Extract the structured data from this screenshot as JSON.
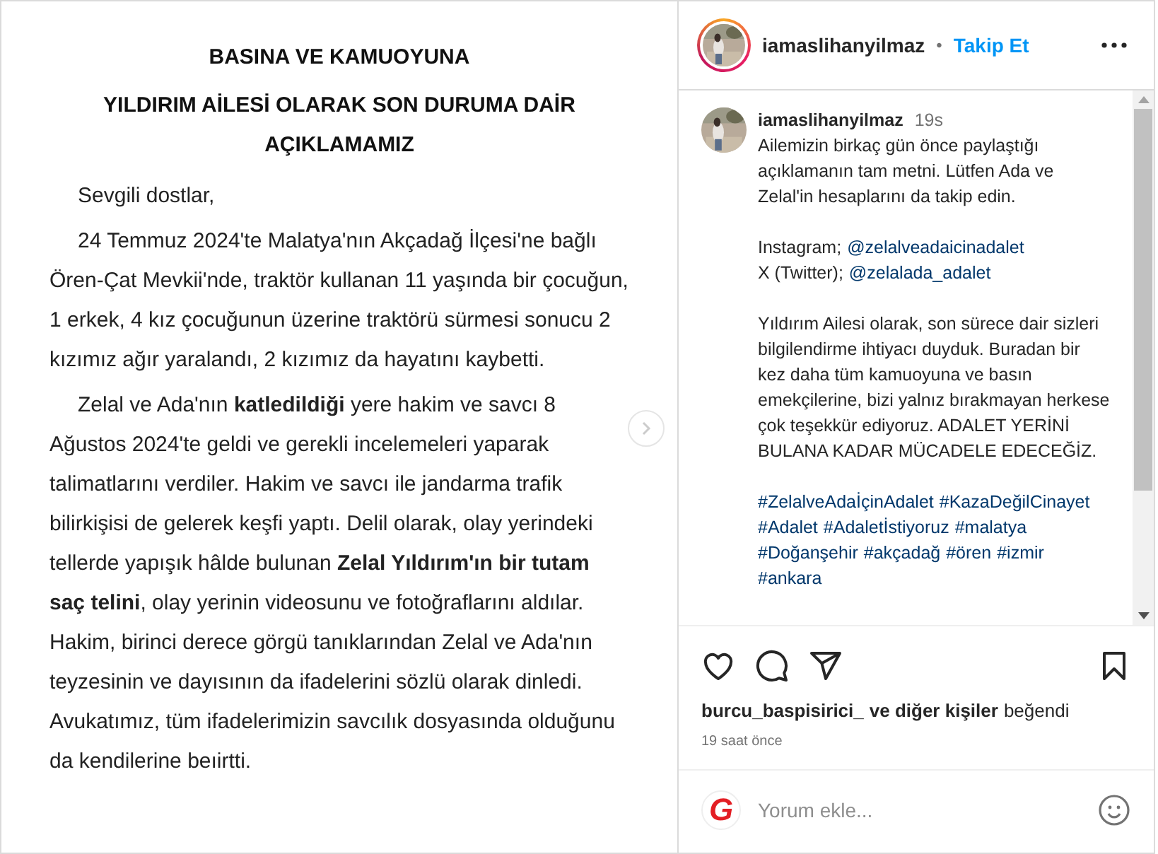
{
  "document": {
    "headings": [
      "BASINA VE KAMUOYUNA",
      "YILDIRIM AİLESİ OLARAK SON DURUMA DAİR AÇIKLAMAMIZ"
    ],
    "paragraphs": [
      "Sevgili dostlar,",
      "24 Temmuz 2024'te Malatya'nın Akçadağ İlçesi'ne bağlı Ören-Çat Mevkii'nde, traktör kullanan 11 yaşında bir çocuğun, 1 erkek, 4 kız çocuğunun üzerine traktörü sürmesi sonucu 2 kızımız ağır yaralandı, 2 kızımız da hayatını kaybetti.",
      "Zelal ve Ada'nın **katledildiği** yere hakim ve savcı 8 Ağustos 2024'te geldi ve gerekli incelemeleri yaparak talimatlarını verdiler. Hakim ve savcı ile jandarma trafik bilirkişisi de gelerek keşfi yaptı. Delil olarak, olay yerindeki tellerde yapışık hâlde bulunan **Zelal Yıldırım'ın bir tutam saç telini**, olay yerinin videosunu ve fotoğraflarını aldılar. Hakim, birinci derece görgü tanıklarından Zelal ve Ada'nın teyzesinin ve dayısının da ifadelerini sözlü olarak dinledi. Avukatımız, tüm ifadelerimizin savcılık dosyasında olduğunu da kendilerine beıirtti."
    ]
  },
  "header": {
    "username": "iamaslihanyilmaz",
    "separator": "•",
    "follow": "Takip Et"
  },
  "caption": {
    "username": "iamaslihanyilmaz",
    "time": "19s",
    "intro": "Ailemizin birkaç gün önce paylaştığı açıklamanın tam metni. Lütfen Ada ve Zelal'in hesaplarını da takip edin.",
    "accounts": [
      {
        "label": "Instagram;",
        "handle": "@zelalveadaicinadalet"
      },
      {
        "label": "X (Twitter);",
        "handle": "@zelalada_adalet"
      }
    ],
    "body": "Yıldırım Ailesi olarak, son sürece dair sizleri bilgilendirme ihtiyacı duyduk. Buradan bir kez daha tüm kamuoyuna ve basın emekçilerine, bizi yalnız bırakmayan herkese çok teşekkür ediyoruz. ADALET YERİNİ BULANA KADAR MÜCADELE EDECEĞİZ.",
    "hashtags": [
      "#ZelalveAdaİçinAdalet",
      "#KazaDeğilCinayet",
      "#Adalet",
      "#Adaletİstiyoruz",
      "#malatya",
      "#Doğanşehir",
      "#akçadağ",
      "#ören",
      "#izmir",
      "#ankara"
    ]
  },
  "likes": {
    "user": "burcu_baspisirici_",
    "others": "ve diğer kişiler",
    "verb": "beğendi"
  },
  "time_ago": "19 saat önce",
  "comment": {
    "avatar_letter": "G",
    "placeholder": "Yorum ekle..."
  }
}
